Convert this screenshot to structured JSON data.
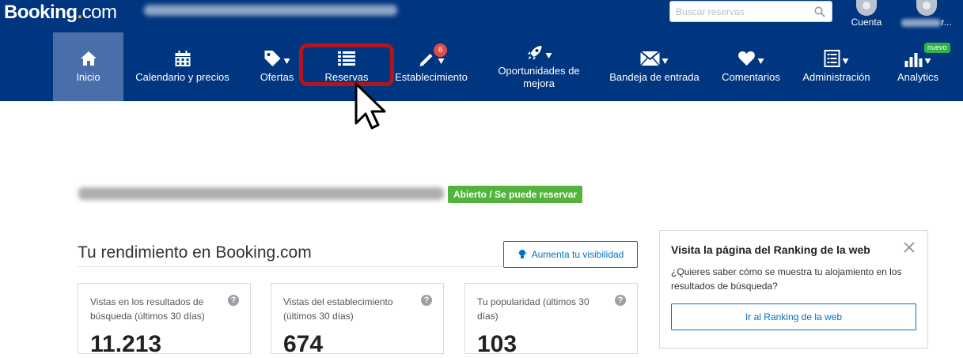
{
  "brand": {
    "name": "Booking",
    "dot": ".",
    "suffix": "com"
  },
  "header": {
    "search_placeholder": "Buscar reservas",
    "account_label": "Cuenta",
    "user_suffix": "r..."
  },
  "nav": {
    "items": [
      {
        "label": "Inicio",
        "icon": "home-icon",
        "active": true
      },
      {
        "label": "Calendario y precios",
        "icon": "calendar-icon"
      },
      {
        "label": "Ofertas",
        "icon": "tag-icon"
      },
      {
        "label": "Reservas",
        "icon": "list-icon"
      },
      {
        "label": "Establecimiento",
        "icon": "pencil-icon"
      },
      {
        "label": "Oportunidades de mejora",
        "icon": "rocket-icon"
      },
      {
        "label": "Bandeja de entrada",
        "icon": "envelope-icon"
      },
      {
        "label": "Comentarios",
        "icon": "heart-icon"
      },
      {
        "label": "Administración",
        "icon": "document-icon"
      },
      {
        "label": "Analytics",
        "icon": "bar-chart-icon"
      }
    ],
    "establishment_badge": "6",
    "analytics_badge": "nuevo"
  },
  "property": {
    "status": "Abierto / Se puede reservar"
  },
  "performance": {
    "title": "Tu rendimiento en Booking.com",
    "visibility_button": "Aumenta tu visibilidad",
    "cards": [
      {
        "label": "Vistas en los resultados de búsqueda (últimos 30 días)",
        "value": "11.213"
      },
      {
        "label": "Vistas del establecimiento (últimos 30 días)",
        "value": "674"
      },
      {
        "label": "Tu popularidad (últimos 30 días)",
        "value": "103"
      }
    ]
  },
  "ranking": {
    "title": "Visita la página del Ranking de la web",
    "body": "¿Quieres saber cómo se muestra tu alojamiento en los resultados de búsqueda?",
    "button": "Ir al Ranking de la web"
  },
  "colors": {
    "brand_blue": "#003580",
    "active_tab": "#4a6ea9",
    "link_blue": "#0071c2",
    "open_green": "#53b33b",
    "highlight_red": "#b3151d"
  }
}
